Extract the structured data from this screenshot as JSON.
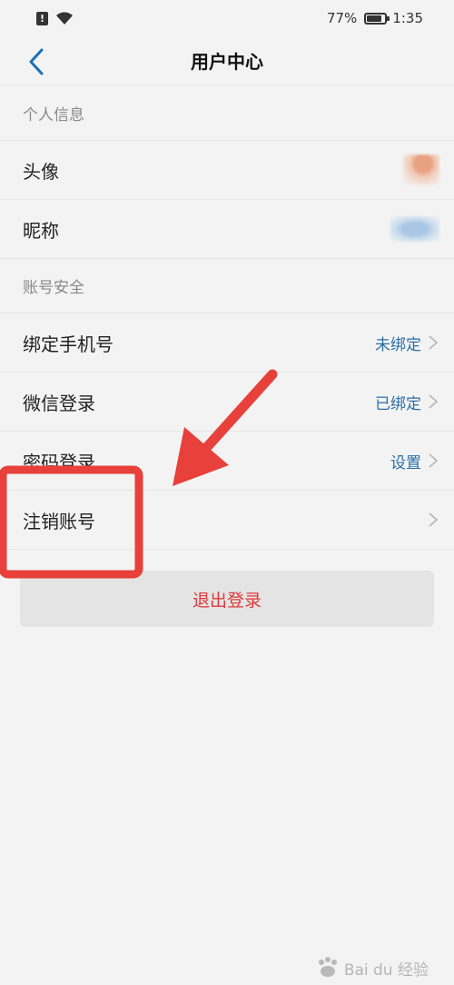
{
  "status_bar": {
    "battery_percent": "77%",
    "battery_level": 0.77,
    "time": "1:35",
    "icons": [
      "alert-icon",
      "wifi-icon",
      "battery-icon"
    ]
  },
  "nav": {
    "title": "用户中心",
    "back_icon": "chevron-left-icon"
  },
  "sections": [
    {
      "header": "个人信息",
      "rows": [
        {
          "label": "头像",
          "value": ""
        },
        {
          "label": "昵称",
          "value": ""
        }
      ]
    },
    {
      "header": "账号安全",
      "rows": [
        {
          "label": "绑定手机号",
          "value": "未绑定"
        },
        {
          "label": "微信登录",
          "value": "已绑定"
        },
        {
          "label": "密码登录",
          "value": "设置"
        },
        {
          "label": "注销账号",
          "value": ""
        }
      ]
    }
  ],
  "logout_label": "退出登录",
  "watermark_text": "Bai du 经验",
  "colors": {
    "accent": "#1a6fb5",
    "value_text": "#2a6fa8",
    "logout_text": "#e0393b",
    "annotation": "#e8403a",
    "background": "#f3f3f3"
  }
}
